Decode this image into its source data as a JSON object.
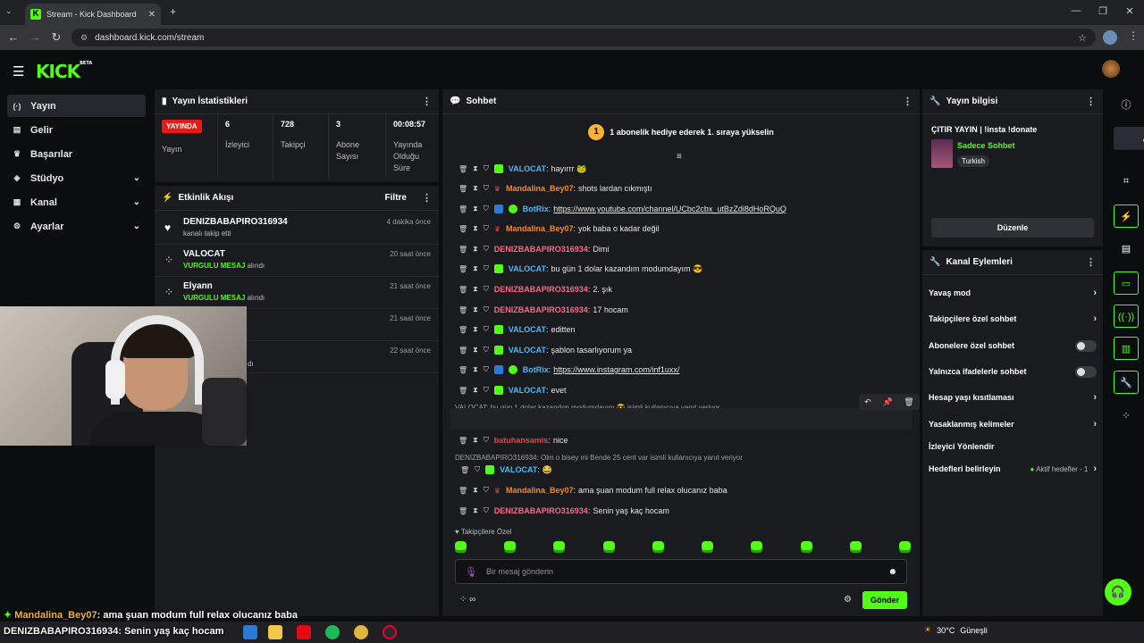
{
  "browser": {
    "tab_title": "Stream - Kick Dashboard",
    "url": "dashboard.kick.com/stream"
  },
  "header": {
    "logo": "KICK",
    "logo_sup": "BETA"
  },
  "sidebar": {
    "items": [
      {
        "label": "Yayın",
        "icon": "broadcast-icon"
      },
      {
        "label": "Gelir",
        "icon": "dollar-icon"
      },
      {
        "label": "Başarılar",
        "icon": "trophy-icon"
      },
      {
        "label": "Stüdyo",
        "icon": "studio-icon"
      },
      {
        "label": "Kanal",
        "icon": "channel-icon"
      },
      {
        "label": "Ayarlar",
        "icon": "settings-icon"
      }
    ]
  },
  "stats": {
    "title": "Yayın İstatistikleri",
    "live_badge": "YAYINDA",
    "live_label": "Yayın",
    "viewers": "6",
    "viewers_label": "İzleyici",
    "followers": "728",
    "followers_label": "Takipçi",
    "subs": "3",
    "subs_label": "Abone Sayısı",
    "duration": "00:08:57",
    "duration_label": "Yayında Olduğu Süre"
  },
  "activity": {
    "title": "Etkinlik Akışı",
    "filter": "Filtre",
    "items": [
      {
        "name": "DENIZBABAPIRO316934",
        "desc": "kanalı takip etti",
        "time": "4 dakika önce"
      },
      {
        "name": "VALOCAT",
        "hl": "VURGULU MESAJ",
        "desc": "alındı",
        "time": "20 saat önce"
      },
      {
        "name": "Elyann",
        "hl": "VURGULU MESAJ",
        "desc": "alındı",
        "time": "21 saat önce"
      },
      {
        "time": "21 saat önce"
      },
      {
        "desc": "dı",
        "time": "22 saat önce"
      }
    ]
  },
  "chat": {
    "title": "Sohbet",
    "banner_num": "1",
    "banner_text": "1 abonelik hediye ederek 1. sıraya yükselin",
    "messages": [
      {
        "user": "VALOCAT",
        "text": "hayırrr 🐸"
      },
      {
        "user": "Mandalina_Bey07",
        "text": "shots lardan cıkmıştı"
      },
      {
        "user": "BotRix",
        "link": "https://www.youtube.com/channel/UCbc2cbx_utBzZdi8dHoRQuQ"
      },
      {
        "user": "Mandalina_Bey07",
        "text": "yok baba o kadar değil"
      },
      {
        "user": "DENIZBABAPIRO316934",
        "text": "Dimi"
      },
      {
        "user": "VALOCAT",
        "text": "bu gün 1 dolar kazandım modumdayım 😎"
      },
      {
        "user": "DENIZBABAPIRO316934",
        "text": "2. şık"
      },
      {
        "user": "DENIZBABAPIRO316934",
        "text": "17 hocam"
      },
      {
        "user": "VALOCAT",
        "text": "editten"
      },
      {
        "user": "VALOCAT",
        "text": "şablon tasarlıyorum ya"
      },
      {
        "user": "BotRix",
        "link": "https://www.instagram.com/inf1uxx/"
      },
      {
        "user": "VALOCAT",
        "text": "evet"
      },
      {
        "user": "DENIZBABAPIRO316934",
        "text": "Olm o bisey mi Bende 25 cent var"
      },
      {
        "user": "batuhansamis",
        "text": "nice"
      },
      {
        "user": "VALOCAT",
        "text": "😂"
      },
      {
        "user": "Mandalina_Bey07",
        "text": "ama şuan modum full relax olucanız baba"
      },
      {
        "user": "DENIZBABAPIRO316934",
        "text": "Senin yaş kaç hocam"
      }
    ],
    "reply1": "VALOCAT: bu gün 1 dolar kazandım modumdayım 😎 isimli kullanıcıya yanıt veriyor",
    "reply2": "DENIZBABAPIRO316934: Olm o bisey mi Bende 25 cent var isimli kullanıcıya yanıt veriyor",
    "followers_only": "Takipçilere Özel",
    "placeholder": "Bir mesaj gönderin",
    "send": "Gönder",
    "points": "∞"
  },
  "stream_info": {
    "title": "Yayın bilgisi",
    "stream_title": "ÇITIR YAYIN | !insta !donate",
    "category": "Sadece Sohbet",
    "tag": "Turkish",
    "edit": "Düzenle"
  },
  "channel_actions": {
    "title": "Kanal Eylemleri",
    "items": [
      {
        "label": "Yavaş mod",
        "kind": "chev"
      },
      {
        "label": "Takipçilere özel sohbet",
        "kind": "chev"
      },
      {
        "label": "Abonelere özel sohbet",
        "kind": "toggle"
      },
      {
        "label": "Yalnızca ifadelerle sohbet",
        "kind": "toggle"
      },
      {
        "label": "Hesap yaşı kısıtlaması",
        "kind": "chev"
      },
      {
        "label": "Yasaklanmış kelimeler",
        "kind": "chev"
      },
      {
        "label": "İzleyici Yönlendir",
        "kind": "none"
      },
      {
        "label": "Hedefleri belirleyin",
        "kind": "chev",
        "sub": "Aktif hedefler - 1"
      }
    ]
  },
  "overlay": {
    "line1_user": "Mandalina_Bey07",
    "line1_text": ": ama şuan modum full relax olucanız baba",
    "line2_user": "DENIZBABAPIRO316934",
    "line2_text": ": Senin yaş kaç hocam"
  },
  "taskbar": {
    "weather": "30°C",
    "weather_desc": "Güneşli"
  },
  "colors": {
    "accent": "#53fc18",
    "live": "#e91916",
    "mod_orange": "#f28a2e",
    "pink": "#f56b8a"
  }
}
